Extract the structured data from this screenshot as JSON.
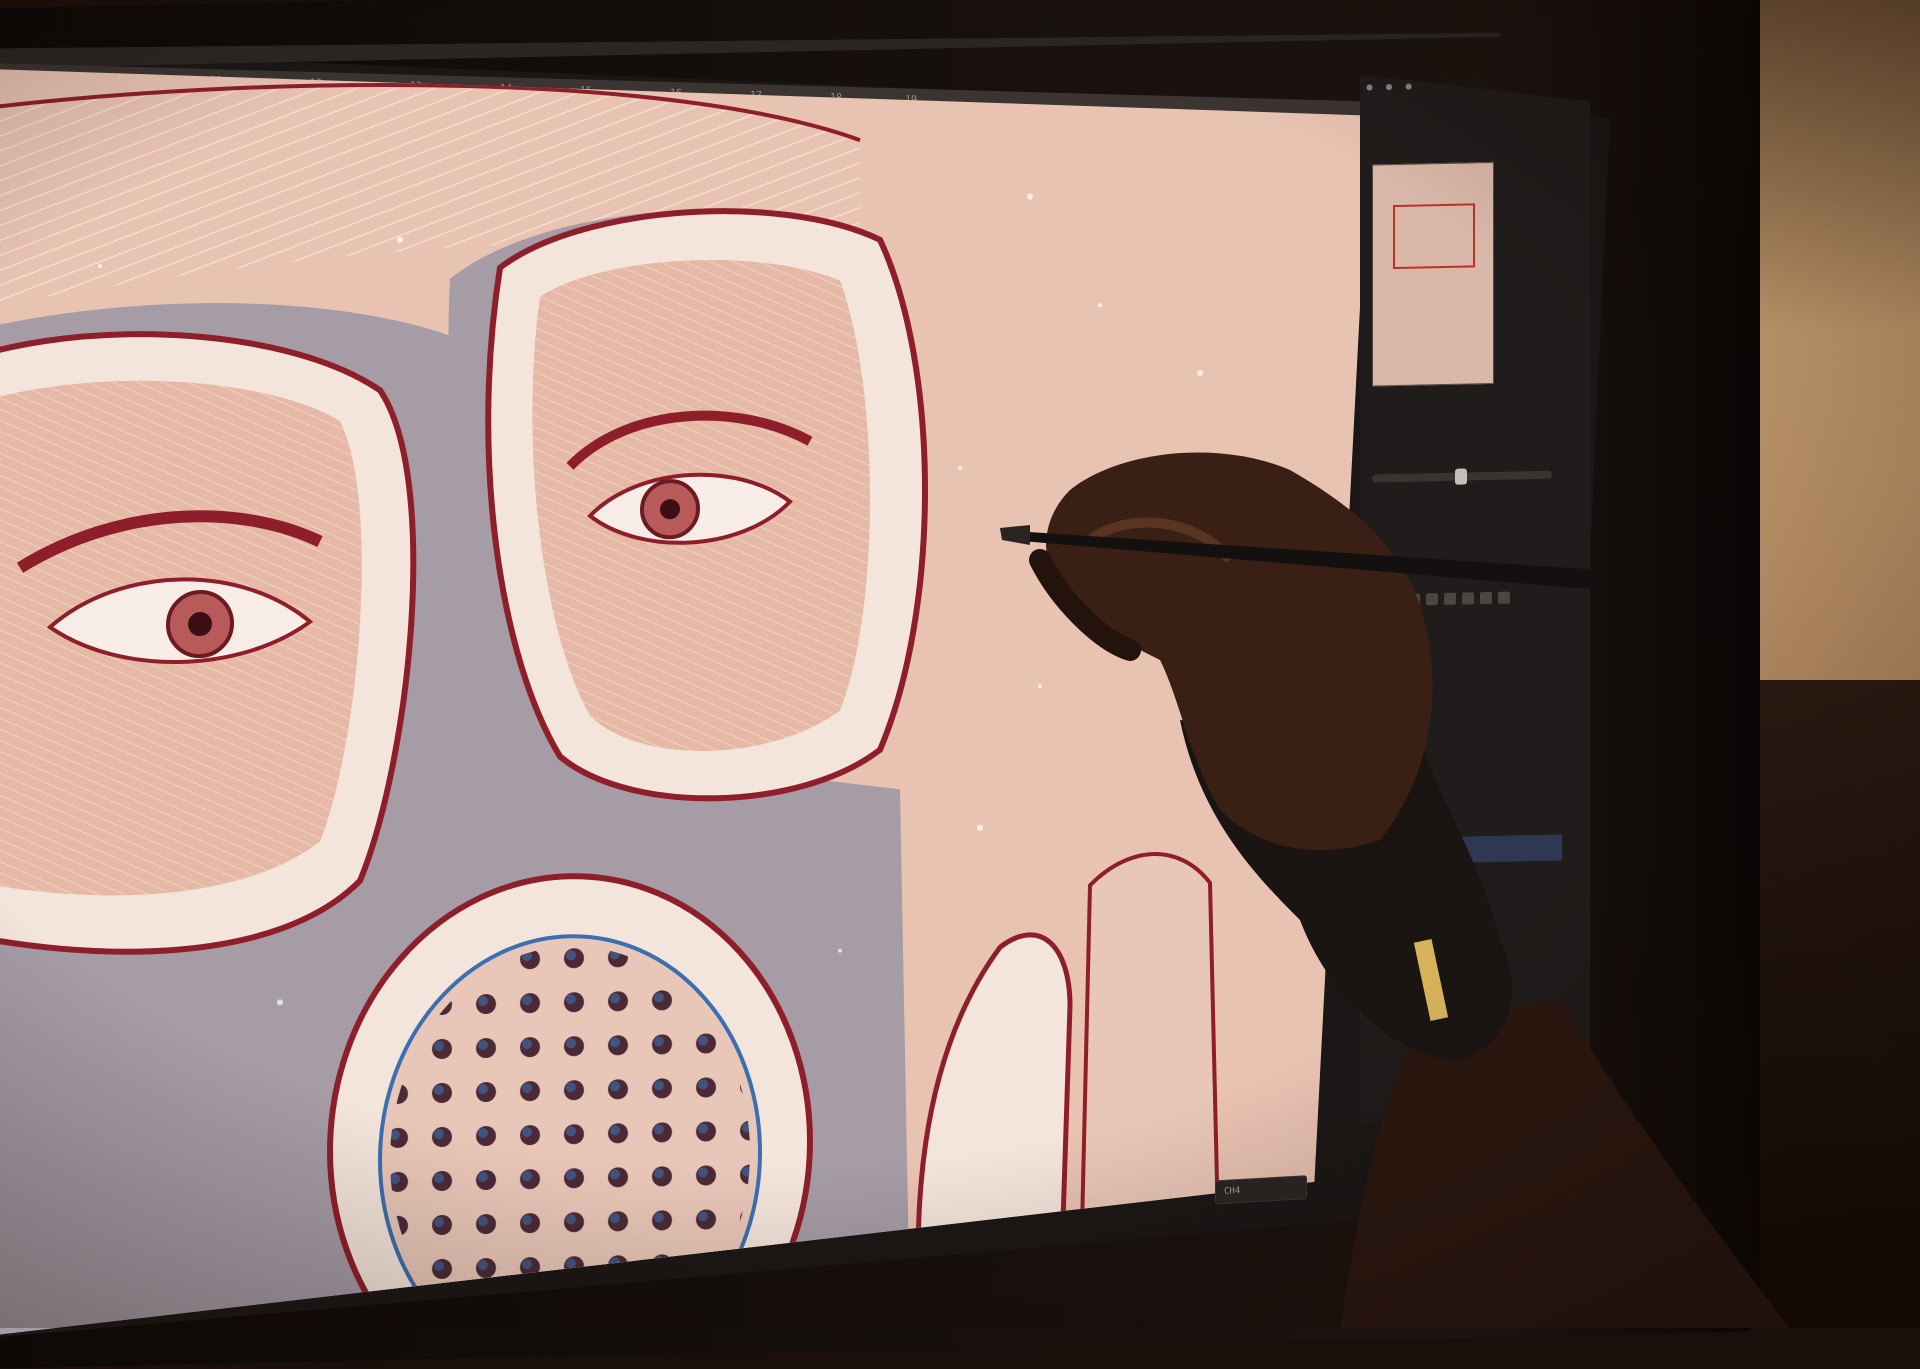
{
  "scene": {
    "description_free": true,
    "colors": {
      "paper": "#e9c3b2",
      "mask_gray": "#a59ca6",
      "line_red": "#8e1f2a",
      "line_blue": "#3a6fb0",
      "highlight": "#f4e5dc",
      "ui_dark": "#201c1b",
      "wall_warm": "#c9a072"
    }
  },
  "app": {
    "ruler_ticks": [
      "10",
      "11",
      "12",
      "13",
      "14",
      "15",
      "16",
      "17",
      "18",
      "19"
    ],
    "zoom_readout": "CH4",
    "panel_tab_icons": [
      "dot-icon",
      "dot-icon",
      "dot-icon"
    ],
    "layers": [
      {
        "swatch": "#e0b82e",
        "name": ""
      },
      {
        "swatch": "#ffffff",
        "name": ""
      },
      {
        "swatch": "#ffffff",
        "name": ""
      },
      {
        "swatch": "#ffffff",
        "name": ""
      },
      {
        "swatch": "#2e63b8",
        "name": ""
      },
      {
        "swatch": "#ffffff",
        "name": ""
      },
      {
        "swatch": "#2e63b8",
        "name": ""
      }
    ]
  },
  "icons": [
    "pen-stylus-icon",
    "drawing-glove-icon",
    "navigator-thumbnail-icon",
    "layer-swatch-icon",
    "zoom-slider-icon"
  ]
}
